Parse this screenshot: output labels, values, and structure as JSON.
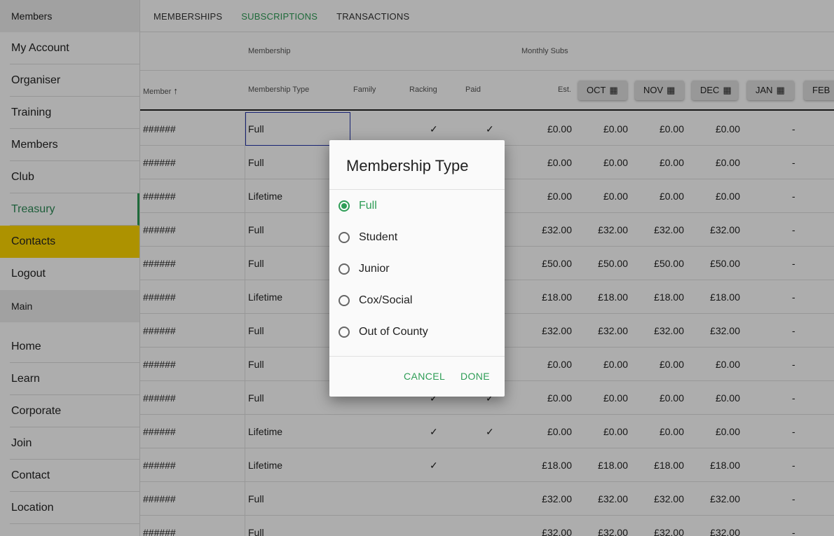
{
  "sidebar": {
    "header": "Members",
    "items": [
      "My Account",
      "Organiser",
      "Training",
      "Members",
      "Club",
      "Treasury",
      "Contacts",
      "Logout"
    ],
    "section": "Main",
    "main_items": [
      "Home",
      "Learn",
      "Corporate",
      "Join",
      "Contact",
      "Location"
    ]
  },
  "tabs": [
    "MEMBERSHIPS",
    "SUBSCRIPTIONS",
    "TRANSACTIONS"
  ],
  "table": {
    "group_headers": {
      "membership": "Membership",
      "monthly_subs": "Monthly Subs"
    },
    "columns": {
      "member": "Member",
      "membership_type": "Membership Type",
      "family": "Family",
      "racking": "Racking",
      "paid": "Paid",
      "est": "Est."
    },
    "sort_icon": "arrow-up-icon",
    "months": [
      "OCT",
      "NOV",
      "DEC",
      "JAN",
      "FEB"
    ],
    "month_icon": "calculator-icon",
    "rows": [
      {
        "member": "######",
        "type": "Full",
        "racking": "✓",
        "paid": "✓",
        "est": "£0.00",
        "oct": "£0.00",
        "nov": "£0.00",
        "dec": "£0.00",
        "jan": "-"
      },
      {
        "member": "######",
        "type": "Full",
        "racking": "",
        "paid": "",
        "est": "£0.00",
        "oct": "£0.00",
        "nov": "£0.00",
        "dec": "£0.00",
        "jan": "-"
      },
      {
        "member": "######",
        "type": "Lifetime",
        "racking": "",
        "paid": "",
        "est": "£0.00",
        "oct": "£0.00",
        "nov": "£0.00",
        "dec": "£0.00",
        "jan": "-"
      },
      {
        "member": "######",
        "type": "Full",
        "racking": "",
        "paid": "",
        "est": "£32.00",
        "oct": "£32.00",
        "nov": "£32.00",
        "dec": "£32.00",
        "jan": "-"
      },
      {
        "member": "######",
        "type": "Full",
        "racking": "",
        "paid": "",
        "est": "£50.00",
        "oct": "£50.00",
        "nov": "£50.00",
        "dec": "£50.00",
        "jan": "-"
      },
      {
        "member": "######",
        "type": "Lifetime",
        "racking": "",
        "paid": "",
        "est": "£18.00",
        "oct": "£18.00",
        "nov": "£18.00",
        "dec": "£18.00",
        "jan": "-"
      },
      {
        "member": "######",
        "type": "Full",
        "racking": "",
        "paid": "",
        "est": "£32.00",
        "oct": "£32.00",
        "nov": "£32.00",
        "dec": "£32.00",
        "jan": "-"
      },
      {
        "member": "######",
        "type": "Full",
        "racking": "",
        "paid": "",
        "est": "£0.00",
        "oct": "£0.00",
        "nov": "£0.00",
        "dec": "£0.00",
        "jan": "-"
      },
      {
        "member": "######",
        "type": "Full",
        "racking": "✓",
        "paid": "✓",
        "est": "£0.00",
        "oct": "£0.00",
        "nov": "£0.00",
        "dec": "£0.00",
        "jan": "-"
      },
      {
        "member": "######",
        "type": "Lifetime",
        "racking": "✓",
        "paid": "✓",
        "est": "£0.00",
        "oct": "£0.00",
        "nov": "£0.00",
        "dec": "£0.00",
        "jan": "-"
      },
      {
        "member": "######",
        "type": "Lifetime",
        "racking": "✓",
        "paid": "",
        "est": "£18.00",
        "oct": "£18.00",
        "nov": "£18.00",
        "dec": "£18.00",
        "jan": "-"
      },
      {
        "member": "######",
        "type": "Full",
        "racking": "",
        "paid": "",
        "est": "£32.00",
        "oct": "£32.00",
        "nov": "£32.00",
        "dec": "£32.00",
        "jan": "-"
      },
      {
        "member": "######",
        "type": "Full",
        "racking": "",
        "paid": "",
        "est": "£32.00",
        "oct": "£32.00",
        "nov": "£32.00",
        "dec": "£32.00",
        "jan": "-"
      }
    ]
  },
  "dialog": {
    "title": "Membership Type",
    "options": [
      "Full",
      "Student",
      "Junior",
      "Cox/Social",
      "Out of County"
    ],
    "selected": "Full",
    "cancel": "CANCEL",
    "done": "DONE"
  },
  "colors": {
    "accent": "#2e9d56",
    "highlight": "#ffd700"
  }
}
